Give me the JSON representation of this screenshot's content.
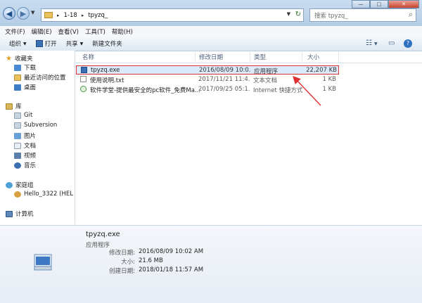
{
  "address": {
    "crumbs": [
      "1-18",
      "tpyzq_"
    ]
  },
  "search": {
    "placeholder": "搜索 tpyzq_"
  },
  "window_controls": {
    "minimize": "—",
    "maximize": "□",
    "close": "✕"
  },
  "menu": [
    "文件(F)",
    "编辑(E)",
    "查看(V)",
    "工具(T)",
    "帮助(H)"
  ],
  "toolbar": {
    "organize": "组织",
    "open": "打开",
    "share": "共享",
    "new_folder": "新建文件夹"
  },
  "nav": {
    "favorites": "收藏夹",
    "favorites_items": [
      "下载",
      "最近访问的位置",
      "桌面"
    ],
    "library": "库",
    "library_items": [
      "Git",
      "Subversion",
      "图片",
      "文档",
      "视频",
      "音乐"
    ],
    "homegroup": "家庭组",
    "homegroup_items": [
      "Hello_3322 (HEL"
    ],
    "computer": "计算机"
  },
  "columns": {
    "name": "名称",
    "date": "修改日期",
    "type": "类型",
    "size": "大小"
  },
  "files": [
    {
      "name": "tpyzq.exe",
      "date": "2016/08/09 10:0...",
      "type": "应用程序",
      "size": "22,207 KB"
    },
    {
      "name": "使用说明.txt",
      "date": "2017/11/21 11:4...",
      "type": "文本文档",
      "size": "1 KB"
    },
    {
      "name": "软件学堂-提供最安全的pc软件_免费Ma...",
      "date": "2017/09/25 05:1...",
      "type": "Internet 快捷方式",
      "size": "1 KB"
    }
  ],
  "details": {
    "name": "tpyzq.exe",
    "type": "应用程序",
    "modified_label": "修改日期:",
    "modified": "2016/08/09 10:02 AM",
    "size_label": "大小:",
    "size": "21.6 MB",
    "created_label": "创建日期:",
    "created": "2018/01/18 11:57 AM"
  },
  "colors": {
    "selection": "#dcebfc",
    "highlight": "#e03030",
    "title_bar": "#c9ddf0"
  }
}
